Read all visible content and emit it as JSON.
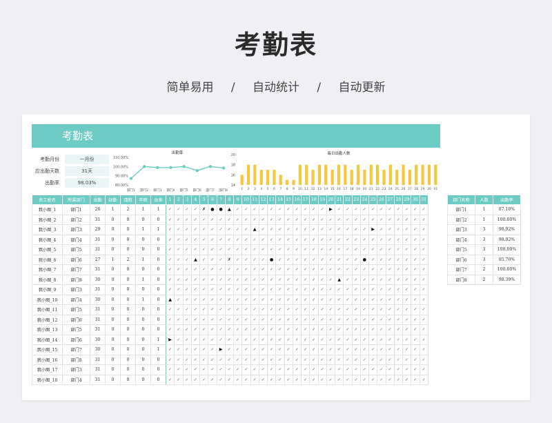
{
  "hero": {
    "title": "考勤表",
    "tags": [
      "简单易用",
      "自动统计",
      "自动更新"
    ],
    "separator": "/"
  },
  "sheet": {
    "title": "考勤表",
    "info": [
      {
        "label": "考勤月份",
        "value": "一月份"
      },
      {
        "label": "应出勤天数",
        "value": "31天"
      },
      {
        "label": "出勤率",
        "value": "98.03%"
      }
    ]
  },
  "colors": {
    "accent": "#6ccbc5",
    "bar": "#f5c842",
    "line": "#6ccbc5"
  },
  "chart_data": [
    {
      "type": "line",
      "title": "出勤率",
      "categories": [
        "部门1",
        "部门2",
        "部门3",
        "部门4",
        "部门5",
        "部门6",
        "部门7",
        "部门8"
      ],
      "values": [
        87.1,
        100.0,
        98.92,
        98.92,
        100.0,
        95.7,
        100.0,
        98.39
      ],
      "ylim": [
        80,
        110
      ],
      "yticks": [
        "80.00%",
        "90.00%",
        "100.00%",
        "110.00%"
      ]
    },
    {
      "type": "bar",
      "title": "每日出勤人数",
      "categories": [
        "1",
        "2",
        "3",
        "4",
        "5",
        "6",
        "7",
        "8",
        "9",
        "10",
        "11",
        "12",
        "13",
        "14",
        "15",
        "16",
        "17",
        "18",
        "19",
        "20",
        "21",
        "22",
        "23",
        "24",
        "25",
        "26",
        "27",
        "28",
        "29",
        "30",
        "31"
      ],
      "values": [
        16,
        18,
        18,
        17,
        17,
        17,
        16,
        15,
        15,
        18,
        18,
        17,
        18,
        18,
        17,
        18,
        18,
        17,
        18,
        17,
        18,
        18,
        17,
        18,
        17,
        18,
        17,
        18,
        18,
        18,
        18
      ],
      "ylim": [
        14,
        20
      ],
      "yticks": [
        "14",
        "16",
        "18",
        "20"
      ]
    }
  ],
  "table": {
    "headers": [
      "员工姓名",
      "所属部门",
      "出勤",
      "缺勤",
      "请假",
      "年假",
      "出差"
    ],
    "days": [
      "1",
      "2",
      "3",
      "4",
      "5",
      "6",
      "7",
      "8",
      "9",
      "10",
      "11",
      "12",
      "13",
      "14",
      "15",
      "16",
      "17",
      "18",
      "19",
      "20",
      "21",
      "22",
      "23",
      "24",
      "25",
      "26",
      "27",
      "28",
      "29",
      "30",
      "31"
    ],
    "rows": [
      {
        "name": "我小图_1",
        "dept": "部门1",
        "stats": [
          "26",
          "1",
          "2",
          "1",
          "1"
        ],
        "marks": "✓✓✓✓✗●●▲✓✓✓✓✓✓✓✓✓✓✓▶✓✓✓✓✓✓✓✓✓✓✓"
      },
      {
        "name": "我小图_2",
        "dept": "部门2",
        "stats": [
          "31",
          "0",
          "0",
          "0",
          "0"
        ],
        "marks": "✓✓✓✓✓✓✓✓✓✓✓✓✓✓✓✓✓✓✓✓✓✓✓✓✓✓✓✓✓✓✓"
      },
      {
        "name": "我小图_3",
        "dept": "部门3",
        "stats": [
          "29",
          "0",
          "0",
          "1",
          "1"
        ],
        "marks": "✓✓✓✓✓✓✓✓✓✓▲✓✓✓✓✓✓✓✓✓✓✓✓✓▶✓✓✓✓✓✓"
      },
      {
        "name": "我小图_4",
        "dept": "部门4",
        "stats": [
          "31",
          "0",
          "0",
          "0",
          "0"
        ],
        "marks": "✓✓✓✓✓✓✓✓✓✓✓✓✓✓✓✓✓✓✓✓✓✓✓✓✓✓✓✓✓✓✓"
      },
      {
        "name": "我小图_5",
        "dept": "部门5",
        "stats": [
          "31",
          "0",
          "0",
          "0",
          "0"
        ],
        "marks": "✓✓✓✓✓✓✓✓✓✓✓✓✓✓✓✓✓✓✓✓✓✓✓✓✓✓✓✓✓✓✓"
      },
      {
        "name": "我小图_6",
        "dept": "部门6",
        "stats": [
          "27",
          "1",
          "2",
          "1",
          "0"
        ],
        "marks": "✓✓✓▲✓✓✓✗✓✓✓✓●✓✓✓✓✓✓✓✓✓✓●✓✓✓✓✓✓✓"
      },
      {
        "name": "我小图_7",
        "dept": "部门7",
        "stats": [
          "31",
          "0",
          "0",
          "0",
          "0"
        ],
        "marks": "✓✓✓✓✓✓✓✓✓✓✓✓✓✓✓✓✓✓✓✓✓✓✓✓✓✓✓✓✓✓✓"
      },
      {
        "name": "我小图_8",
        "dept": "部门8",
        "stats": [
          "30",
          "0",
          "0",
          "1",
          "0"
        ],
        "marks": "✓✓✓✓✓✓✓✓✓✓✓✓✓✓✓✓✓✓✓✓▲✓✓✓✓✓✓✓✓✓✓"
      },
      {
        "name": "我小图_9",
        "dept": "部门3",
        "stats": [
          "31",
          "0",
          "0",
          "0",
          "0"
        ],
        "marks": "✓✓✓✓✓✓✓✓✓✓✓✓✓✓✓✓✓✓✓✓✓✓✓✓✓✓✓✓✓✓✓"
      },
      {
        "name": "我小图_10",
        "dept": "部门4",
        "stats": [
          "30",
          "0",
          "0",
          "1",
          "0"
        ],
        "marks": "▲✓✓✓✓✓✓✓✓✓✓✓✓✓✓✓✓✓✓✓✓✓✓✓✓✓✓✓✓✓✓"
      },
      {
        "name": "我小图_11",
        "dept": "部门5",
        "stats": [
          "31",
          "0",
          "0",
          "0",
          "0"
        ],
        "marks": "✓✓✓✓✓✓✓✓✓✓✓✓✓✓✓✓✓✓✓✓✓✓✓✓✓✓✓✓✓✓✓"
      },
      {
        "name": "我小图_12",
        "dept": "部门6",
        "stats": [
          "31",
          "0",
          "0",
          "0",
          "0"
        ],
        "marks": "✓✓✓✓✓✓✓✓✓✓✓✓✓✓✓✓✓✓✓✓✓✓✓✓✓✓✓✓✓✓✓"
      },
      {
        "name": "我小图_13",
        "dept": "部门5",
        "stats": [
          "31",
          "0",
          "0",
          "0",
          "0"
        ],
        "marks": "✓✓✓✓✓✓✓✓✓✓✓✓✓✓✓✓✓✓✓✓✓✓✓✓✓✓✓✓✓✓✓"
      },
      {
        "name": "我小图_14",
        "dept": "部门6",
        "stats": [
          "30",
          "0",
          "0",
          "0",
          "1"
        ],
        "marks": "▶✓✓✓✓✓✓✓✓✓✓✓✓✓✓✓✓✓✓✓✓✓✓✓✓✓✓✓✓✓✓"
      },
      {
        "name": "我小图_15",
        "dept": "部门7",
        "stats": [
          "30",
          "0",
          "0",
          "0",
          "1"
        ],
        "marks": "✓✓✓✓✓✓▶✓✓✓✓✓✓✓✓✓✓✓✓✓✓✓✓✓✓✓✓✓✓✓✓"
      },
      {
        "name": "我小图_16",
        "dept": "部门8",
        "stats": [
          "31",
          "0",
          "0",
          "0",
          "0"
        ],
        "marks": "✓✓✓✓✓✓✓✓✓✓✓✓✓✓✓✓✓✓✓✓✓✓✓✓✓✓✓✓✓✓✓"
      },
      {
        "name": "我小图_17",
        "dept": "部门3",
        "stats": [
          "31",
          "0",
          "0",
          "0",
          "0"
        ],
        "marks": "✓✓✓✓✓✓✓✓✓✓✓✓✓✓✓✓✓✓✓✓✓✓✓✓✓✓✓✓✓✓✓"
      },
      {
        "name": "我小图_18",
        "dept": "部门4",
        "stats": [
          "31",
          "0",
          "0",
          "0",
          "0"
        ],
        "marks": "✓✓✓✓✓✓✓✓✓✓✓✓✓✓✓✓✓✓✓✓✓✓✓✓✓✓✓✓✓✓✓"
      }
    ]
  },
  "dept_table": {
    "headers": [
      "部门名称",
      "人数",
      "出勤率"
    ],
    "rows": [
      [
        "部门1",
        "1",
        "87.10%"
      ],
      [
        "部门2",
        "1",
        "100.00%"
      ],
      [
        "部门3",
        "3",
        "98.92%"
      ],
      [
        "部门4",
        "3",
        "98.92%"
      ],
      [
        "部门5",
        "3",
        "100.00%"
      ],
      [
        "部门6",
        "3",
        "95.70%"
      ],
      [
        "部门7",
        "2",
        "100.00%"
      ],
      [
        "部门8",
        "2",
        "98.39%"
      ]
    ]
  }
}
